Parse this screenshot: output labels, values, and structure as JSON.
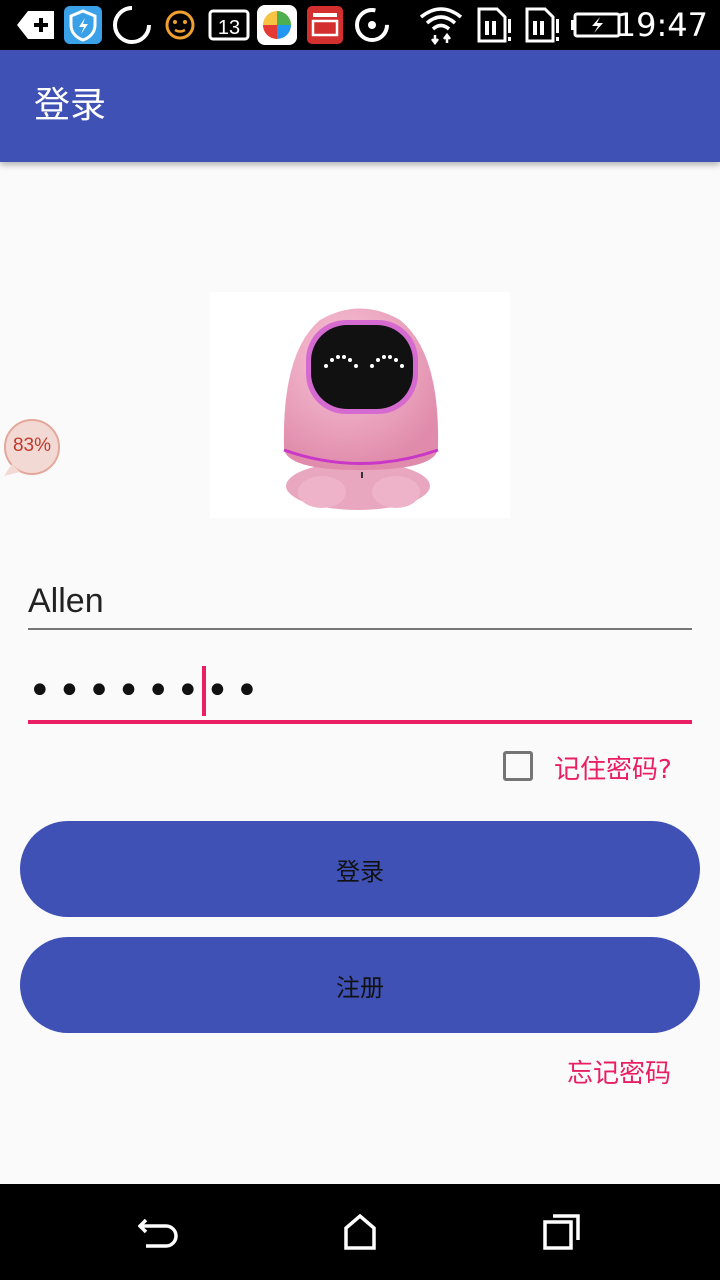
{
  "status_bar": {
    "time": "19:47",
    "notification_count": "13",
    "icons": [
      "add-icon",
      "shield-icon",
      "loading-ring-icon",
      "face-icon",
      "calendar-icon",
      "pinwheel-icon",
      "news-icon",
      "sync-icon",
      "wifi-icon",
      "sim-no-signal-icon",
      "sim-no-signal-icon",
      "battery-charging-icon"
    ]
  },
  "app_bar": {
    "title": "登录"
  },
  "floating_bubble": {
    "label": "83%"
  },
  "login_form": {
    "username_value": "Allen",
    "password_value": "••••••••",
    "remember_label": "记住密码?",
    "remember_checked": false,
    "login_button": "登录",
    "register_button": "注册",
    "forgot_link": "忘记密码"
  },
  "nav_bar": {
    "buttons": [
      "back-icon",
      "home-icon",
      "recents-icon"
    ]
  },
  "colors": {
    "primary": "#3f51b5",
    "accent": "#e91e63",
    "background": "#fafafa"
  }
}
